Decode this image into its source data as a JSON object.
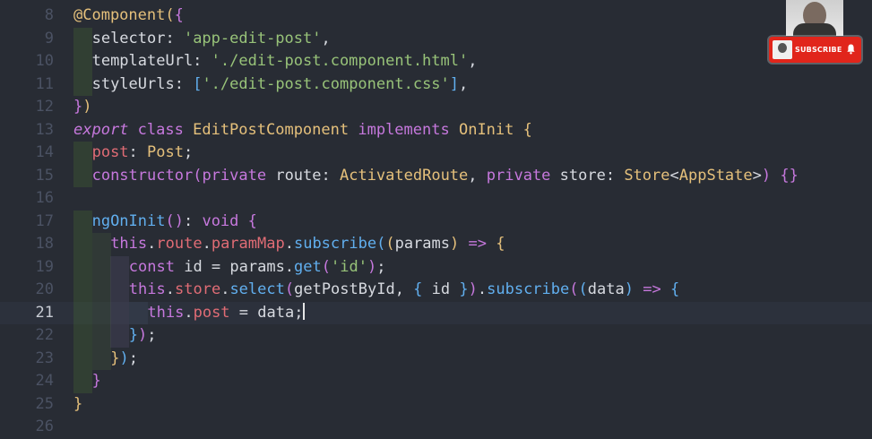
{
  "editor": {
    "current_line": "21",
    "lines": [
      {
        "n": "8",
        "indent": "",
        "tokens": [
          [
            "dec",
            "@Component"
          ],
          [
            "br1",
            "("
          ],
          [
            "br2",
            "{"
          ]
        ]
      },
      {
        "n": "9",
        "indent": "  ",
        "tokens": [
          [
            "plain",
            "selector: "
          ],
          [
            "str",
            "'app-edit-post'"
          ],
          [
            "plain",
            ","
          ]
        ]
      },
      {
        "n": "10",
        "indent": "  ",
        "tokens": [
          [
            "plain",
            "templateUrl: "
          ],
          [
            "str",
            "'./edit-post.component.html'"
          ],
          [
            "plain",
            ","
          ]
        ]
      },
      {
        "n": "11",
        "indent": "  ",
        "tokens": [
          [
            "plain",
            "styleUrls: "
          ],
          [
            "br3",
            "["
          ],
          [
            "str",
            "'./edit-post.component.css'"
          ],
          [
            "br3",
            "]"
          ],
          [
            "plain",
            ","
          ]
        ]
      },
      {
        "n": "12",
        "indent": "",
        "tokens": [
          [
            "br2",
            "}"
          ],
          [
            "br1",
            ")"
          ]
        ]
      },
      {
        "n": "13",
        "indent": "",
        "tokens": [
          [
            "kwi",
            "export"
          ],
          [
            "plain",
            " "
          ],
          [
            "kw",
            "class"
          ],
          [
            "plain",
            " "
          ],
          [
            "cls",
            "EditPostComponent"
          ],
          [
            "plain",
            " "
          ],
          [
            "kw",
            "implements"
          ],
          [
            "plain",
            " "
          ],
          [
            "cls",
            "OnInit"
          ],
          [
            "plain",
            " "
          ],
          [
            "br1",
            "{"
          ]
        ]
      },
      {
        "n": "14",
        "indent": "  ",
        "tokens": [
          [
            "prop",
            "post"
          ],
          [
            "plain",
            ": "
          ],
          [
            "cls",
            "Post"
          ],
          [
            "plain",
            ";"
          ]
        ]
      },
      {
        "n": "15",
        "indent": "  ",
        "tokens": [
          [
            "kw",
            "constructor"
          ],
          [
            "br2",
            "("
          ],
          [
            "kw",
            "private"
          ],
          [
            "plain",
            " route: "
          ],
          [
            "cls",
            "ActivatedRoute"
          ],
          [
            "plain",
            ", "
          ],
          [
            "kw",
            "private"
          ],
          [
            "plain",
            " store: "
          ],
          [
            "cls",
            "Store"
          ],
          [
            "plain",
            "<"
          ],
          [
            "cls",
            "AppState"
          ],
          [
            "plain",
            ">"
          ],
          [
            "br2",
            ")"
          ],
          [
            "plain",
            " "
          ],
          [
            "br2",
            "{}"
          ]
        ]
      },
      {
        "n": "16",
        "indent": "",
        "tokens": []
      },
      {
        "n": "17",
        "indent": "  ",
        "tokens": [
          [
            "fn",
            "ngOnInit"
          ],
          [
            "br2",
            "()"
          ],
          [
            "plain",
            ": "
          ],
          [
            "kw",
            "void"
          ],
          [
            "plain",
            " "
          ],
          [
            "br2",
            "{"
          ]
        ]
      },
      {
        "n": "18",
        "indent": "    ",
        "tokens": [
          [
            "kw",
            "this"
          ],
          [
            "plain",
            "."
          ],
          [
            "prop",
            "route"
          ],
          [
            "plain",
            "."
          ],
          [
            "prop",
            "paramMap"
          ],
          [
            "plain",
            "."
          ],
          [
            "fn",
            "subscribe"
          ],
          [
            "br3",
            "("
          ],
          [
            "br1",
            "("
          ],
          [
            "plain",
            "params"
          ],
          [
            "br1",
            ")"
          ],
          [
            "plain",
            " "
          ],
          [
            "kw",
            "=>"
          ],
          [
            "plain",
            " "
          ],
          [
            "br1",
            "{"
          ]
        ]
      },
      {
        "n": "19",
        "indent": "      ",
        "tokens": [
          [
            "kw",
            "const"
          ],
          [
            "plain",
            " id = params."
          ],
          [
            "fn",
            "get"
          ],
          [
            "br2",
            "("
          ],
          [
            "str",
            "'id'"
          ],
          [
            "br2",
            ")"
          ],
          [
            "plain",
            ";"
          ]
        ]
      },
      {
        "n": "20",
        "indent": "      ",
        "tokens": [
          [
            "kw",
            "this"
          ],
          [
            "plain",
            "."
          ],
          [
            "prop",
            "store"
          ],
          [
            "plain",
            "."
          ],
          [
            "fn",
            "select"
          ],
          [
            "br2",
            "("
          ],
          [
            "plain",
            "getPostById, "
          ],
          [
            "br3",
            "{"
          ],
          [
            "plain",
            " id "
          ],
          [
            "br3",
            "}"
          ],
          [
            "br2",
            ")"
          ],
          [
            "plain",
            "."
          ],
          [
            "fn",
            "subscribe"
          ],
          [
            "br2",
            "("
          ],
          [
            "br3",
            "("
          ],
          [
            "plain",
            "data"
          ],
          [
            "br3",
            ")"
          ],
          [
            "plain",
            " "
          ],
          [
            "kw",
            "=>"
          ],
          [
            "plain",
            " "
          ],
          [
            "br3",
            "{"
          ]
        ]
      },
      {
        "n": "21",
        "indent": "        ",
        "tokens": [
          [
            "kw",
            "this"
          ],
          [
            "plain",
            "."
          ],
          [
            "prop",
            "post"
          ],
          [
            "plain",
            " = data;"
          ]
        ]
      },
      {
        "n": "22",
        "indent": "      ",
        "tokens": [
          [
            "br3",
            "}"
          ],
          [
            "br2",
            ")"
          ],
          [
            "plain",
            ";"
          ]
        ]
      },
      {
        "n": "23",
        "indent": "    ",
        "tokens": [
          [
            "br1",
            "}"
          ],
          [
            "br3",
            ")"
          ],
          [
            "plain",
            ";"
          ]
        ]
      },
      {
        "n": "24",
        "indent": "  ",
        "tokens": [
          [
            "br2",
            "}"
          ]
        ]
      },
      {
        "n": "25",
        "indent": "",
        "tokens": [
          [
            "br1",
            "}"
          ]
        ]
      },
      {
        "n": "26",
        "indent": "",
        "tokens": []
      }
    ]
  },
  "overlay": {
    "subscribe_label": "SUBSCRIBE"
  }
}
